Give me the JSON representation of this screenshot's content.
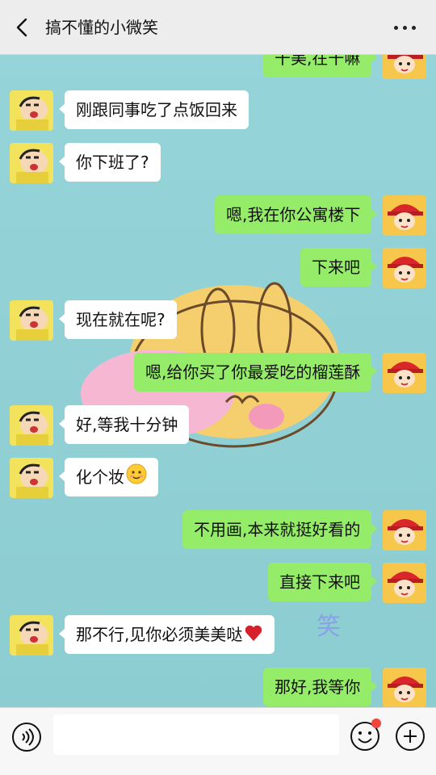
{
  "header": {
    "title": "搞不懂的小微笑"
  },
  "messages": [
    {
      "side": "out",
      "text": "干美,在干嘛"
    },
    {
      "side": "in",
      "text": "刚跟同事吃了点饭回来"
    },
    {
      "side": "in",
      "text": "你下班了?"
    },
    {
      "side": "out",
      "text": "嗯,我在你公寓楼下"
    },
    {
      "side": "out",
      "text": "下来吧"
    },
    {
      "side": "in",
      "text": "现在就在呢?"
    },
    {
      "side": "out",
      "text": "嗯,给你买了你最爱吃的榴莲酥"
    },
    {
      "side": "in",
      "text": "好,等我十分钟"
    },
    {
      "side": "in",
      "text": "化个妆",
      "emoji": "smiling-face-icon"
    },
    {
      "side": "out",
      "text": "不用画,本来就挺好看的"
    },
    {
      "side": "out",
      "text": "直接下来吧"
    },
    {
      "side": "in",
      "text": "那不行,见你必须美美哒",
      "emoji": "red-heart-icon"
    },
    {
      "side": "out",
      "text": "那好,我等你"
    }
  ],
  "background_watermark": "笑",
  "input": {
    "value": ""
  },
  "colors": {
    "outgoing_bubble": "#95ec69",
    "incoming_bubble": "#ffffff",
    "chat_background": "#8fcfd3"
  }
}
